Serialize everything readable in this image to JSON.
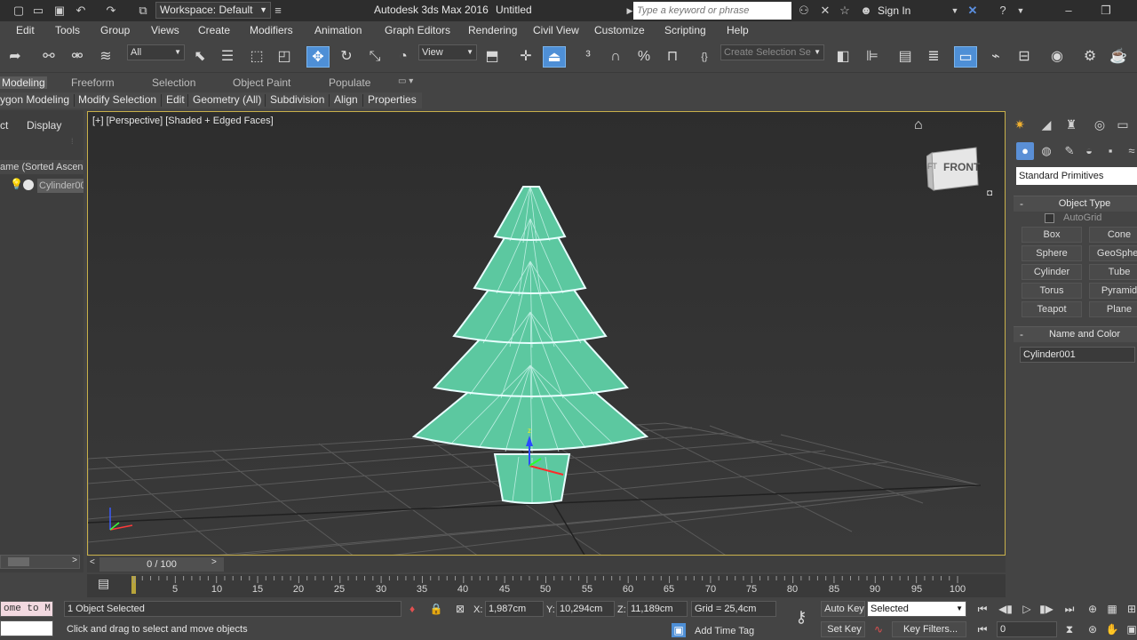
{
  "titlebar": {
    "workspace_label": "Workspace: Default",
    "app_title": "Autodesk 3ds Max 2016",
    "doc_title": "Untitled",
    "search_placeholder": "Type a keyword or phrase",
    "signin_label": "Sign In"
  },
  "menu": [
    "Edit",
    "Tools",
    "Group",
    "Views",
    "Create",
    "Modifiers",
    "Animation",
    "Graph Editors",
    "Rendering",
    "Civil View",
    "Customize",
    "Scripting",
    "Help"
  ],
  "toolbar": {
    "filter_value": "All",
    "refcoord_value": "View",
    "selection_set_placeholder": "Create Selection Se"
  },
  "ribbon": {
    "tabs": [
      "Modeling",
      "Freeform",
      "Selection",
      "Object Paint",
      "Populate"
    ],
    "active_tab": "Modeling",
    "subtabs": [
      "ygon Modeling",
      "Modify Selection",
      "Edit",
      "Geometry (All)",
      "Subdivision",
      "Align",
      "Properties"
    ]
  },
  "explorer": {
    "tab_select": "ct",
    "tab_display": "Display",
    "header": "ame (Sorted Ascen",
    "item_label": "Cylinder00"
  },
  "viewport": {
    "label": "[+] [Perspective] [Shaded + Edged Faces]",
    "viewcube_face": "FRONT",
    "viewcube_side": "FT"
  },
  "command_panel": {
    "primitive_type": "Standard Primitives",
    "object_type_title": "Object Type",
    "autogrid_label": "AutoGrid",
    "buttons": [
      "Box",
      "Cone",
      "Sphere",
      "GeoSpher",
      "Cylinder",
      "Tube",
      "Torus",
      "Pyramid",
      "Teapot",
      "Plane"
    ],
    "name_color_title": "Name and Color",
    "object_name": "Cylinder001"
  },
  "timeline": {
    "slider_label": "0 / 100",
    "ticks": [
      "5",
      "10",
      "15",
      "20",
      "25",
      "30",
      "35",
      "40",
      "45",
      "50",
      "55",
      "60",
      "65",
      "70",
      "75",
      "80",
      "85",
      "90",
      "95",
      "100"
    ]
  },
  "status": {
    "maxscript_text": "ome to M",
    "selection_count": "1 Object Selected",
    "prompt": "Click and drag to select and move objects",
    "x_label": "X:",
    "x_value": "1,987cm",
    "y_label": "Y:",
    "y_value": "10,294cm",
    "z_label": "Z:",
    "z_value": "11,189cm",
    "grid": "Grid = 25,4cm",
    "add_time_tag": "Add Time Tag",
    "auto_key": "Auto Key",
    "set_key": "Set Key",
    "key_mode_value": "Selected",
    "key_filters": "Key Filters...",
    "frame_value": "0"
  },
  "colors": {
    "accent": "#4e8fd6",
    "viewport_border": "#c8b04a",
    "tree_fill": "#5cc8a0",
    "tree_outline": "#e8ffff"
  }
}
